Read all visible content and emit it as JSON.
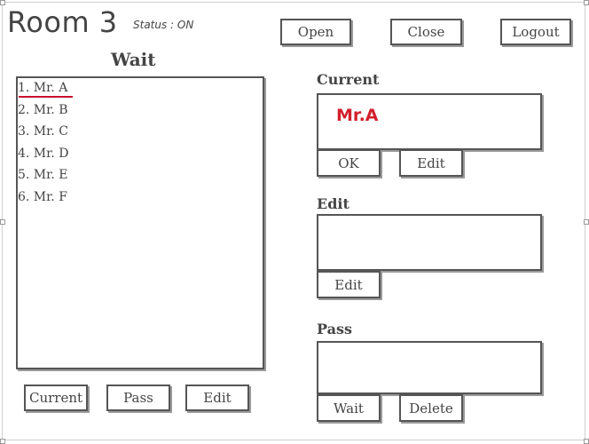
{
  "header": {
    "title": "Room 3",
    "status": "Status : ON",
    "buttons": {
      "open": "Open",
      "close": "Close",
      "logout": "Logout"
    }
  },
  "wait": {
    "heading": "Wait",
    "items": [
      "1. Mr. A",
      "2. Mr. B",
      "3. Mr. C",
      "4. Mr. D",
      "5. Mr. E",
      "6. Mr. F"
    ],
    "selected_index": 0,
    "buttons": {
      "current": "Current",
      "pass": "Pass",
      "edit": "Edit"
    }
  },
  "current": {
    "heading": "Current",
    "value": "Mr.A",
    "buttons": {
      "ok": "OK",
      "edit": "Edit"
    }
  },
  "edit": {
    "heading": "Edit",
    "value": "",
    "buttons": {
      "edit": "Edit"
    }
  },
  "pass": {
    "heading": "Pass",
    "value": "",
    "buttons": {
      "wait": "Wait",
      "delete": "Delete"
    }
  },
  "colors": {
    "accent": "#d21f2c",
    "underline": "#c8102e",
    "border": "#555555"
  }
}
